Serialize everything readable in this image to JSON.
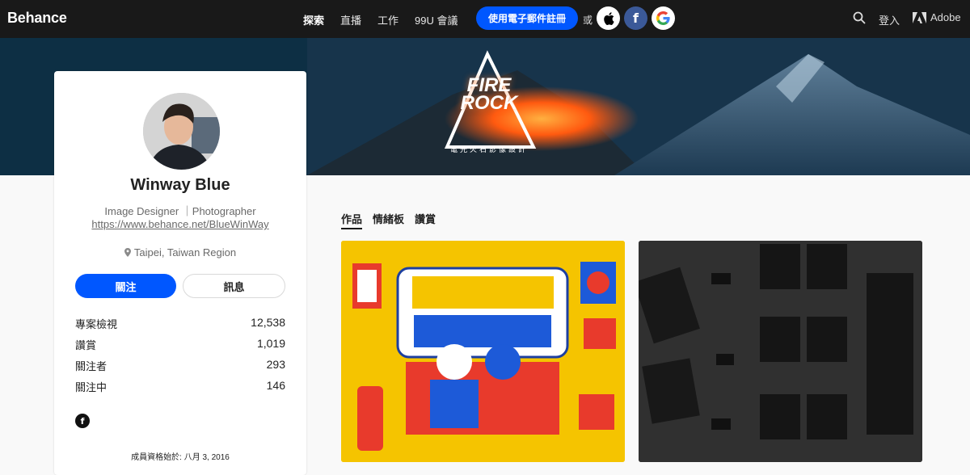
{
  "header": {
    "logo": "Behance",
    "nav": [
      "探索",
      "直播",
      "工作",
      "99U 會議"
    ],
    "nav_active": "探索",
    "signup_label": "使用電子郵件註冊",
    "or_label": "或",
    "social": {
      "apple": "",
      "facebook": "f",
      "google": "G"
    },
    "login_label": "登入",
    "adobe_label": "Adobe"
  },
  "banner": {
    "title_line1": "FIRE",
    "title_line2": "ROCK",
    "subtitle": "電光火石影像設計"
  },
  "profile": {
    "name": "Winway Blue",
    "occupation": "Image Designer ｜Photographer",
    "url": "https://www.behance.net/BlueWinWay",
    "location": "Taipei, Taiwan Region",
    "follow_label": "關注",
    "message_label": "訊息",
    "stats": [
      {
        "label": "專案檢視",
        "value": "12,538"
      },
      {
        "label": "讚賞",
        "value": "1,019"
      },
      {
        "label": "關注者",
        "value": "293"
      },
      {
        "label": "關注中",
        "value": "146"
      }
    ],
    "facebook_icon": "f",
    "member_since": "成員資格始於: 八月 3, 2016"
  },
  "tabs": [
    "作品",
    "情緒板",
    "讚賞"
  ],
  "tabs_active": "作品",
  "colors": {
    "header_bg": "#191919",
    "accent_blue": "#0057ff",
    "tile1_bg": "#f5c400",
    "tile2_bg": "#2d2d2d"
  }
}
